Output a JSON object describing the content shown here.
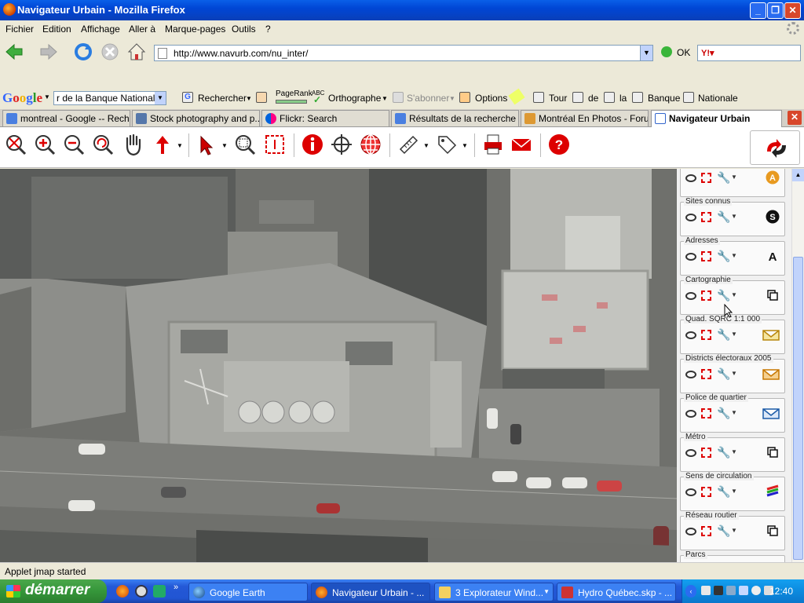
{
  "window": {
    "title": "Navigateur Urbain - Mozilla Firefox"
  },
  "menu": [
    "Fichier",
    "Edition",
    "Affichage",
    "Aller à",
    "Marque-pages",
    "Outils",
    "?"
  ],
  "nav": {
    "url": "http://www.navurb.com/nu_inter/",
    "go_label": "OK"
  },
  "google_bar": {
    "search_value": "r de la Banque Nationale",
    "rechercher": "Rechercher",
    "pagerank": "PageRank",
    "abc": "ABC",
    "orthographe": "Orthographe",
    "sabonner": "S'abonner",
    "options": "Options",
    "words": [
      "Tour",
      "de",
      "la",
      "Banque",
      "Nationale"
    ]
  },
  "tabs": [
    {
      "label": "montreal - Google -- Rech...",
      "color": "#4a7fe0"
    },
    {
      "label": "Stock photography and p...",
      "color": "#5577aa"
    },
    {
      "label": "Flickr: Search",
      "color": "#ff0084"
    },
    {
      "label": "Résultats de la recherche ...",
      "color": "#4a7fe0"
    },
    {
      "label": "Montréal En Photos - Forum",
      "color": "#dd9933"
    },
    {
      "label": "Navigateur Urbain",
      "color": "#3366cc"
    }
  ],
  "layers": [
    {
      "label": "",
      "icon": "letter-a-icon"
    },
    {
      "label": "Sites connus",
      "icon": "letter-s-icon"
    },
    {
      "label": "Adresses",
      "icon": "a-text-icon"
    },
    {
      "label": "Cartographie",
      "icon": "copy-icon"
    },
    {
      "label": "Quad. SQRC 1:1 000",
      "icon": "polygon-icon"
    },
    {
      "label": "Districts électoraux 2005",
      "icon": "polygon-icon"
    },
    {
      "label": "Police de quartier",
      "icon": "polygon-icon"
    },
    {
      "label": "Métro",
      "icon": "copy-icon"
    },
    {
      "label": "Sens de circulation",
      "icon": "arrows-icon"
    },
    {
      "label": "Réseau routier",
      "icon": "copy-icon"
    },
    {
      "label": "Parcs",
      "icon": ""
    }
  ],
  "status": {
    "text": "Applet jmap started"
  },
  "taskbar": {
    "start": "démarrer",
    "tasks": [
      "Google Earth",
      "Navigateur Urbain - ...",
      "3 Explorateur Wind...",
      "Hydro Québec.skp - ..."
    ],
    "clock": "12:40"
  }
}
